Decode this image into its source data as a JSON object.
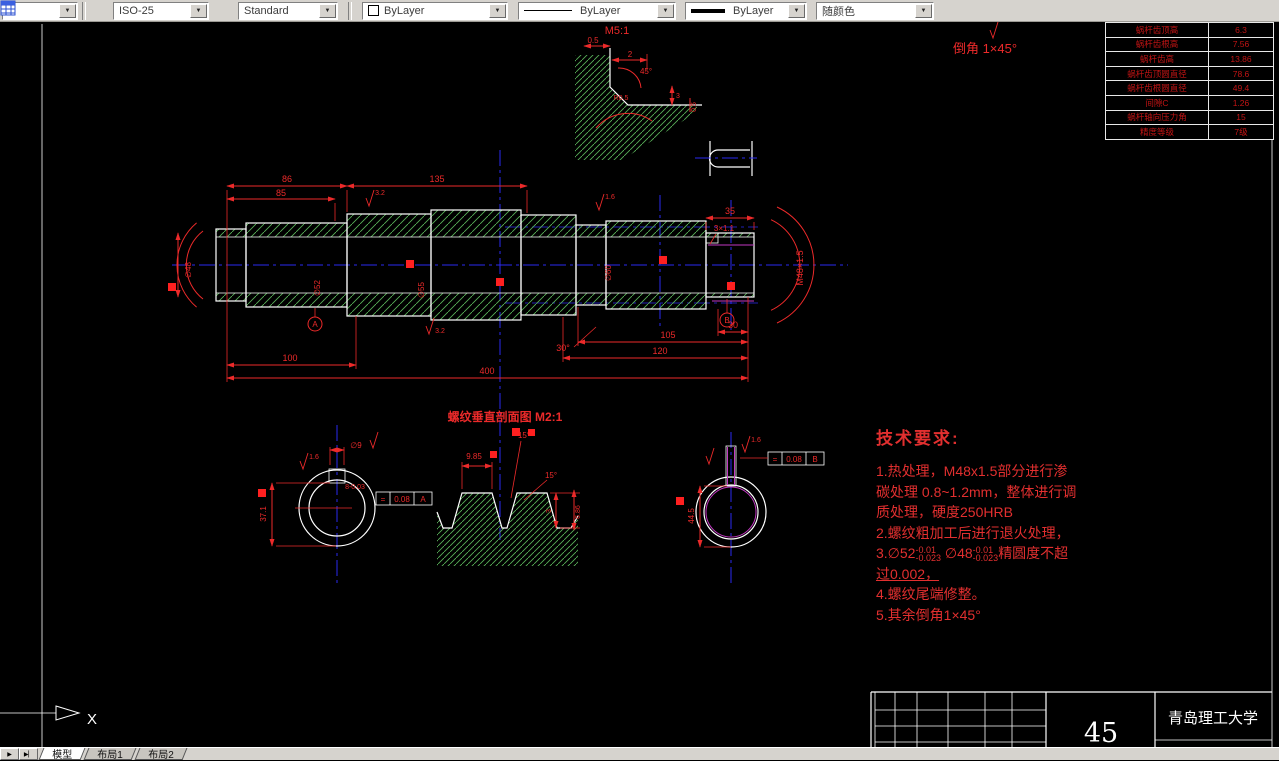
{
  "toolbar": {
    "layer_value": "",
    "dim_style": "ISO-25",
    "text_style": "Standard",
    "color": "ByLayer",
    "linetype": "ByLayer",
    "lineweight": "ByLayer",
    "plot_style": "随颜色",
    "arrow_glyph": "▼"
  },
  "params_table": {
    "rows": [
      {
        "label": "蜗杆齿顶高",
        "value": "6.3"
      },
      {
        "label": "蜗杆齿根高",
        "value": "7.56"
      },
      {
        "label": "蜗杆齿高",
        "value": "13.86"
      },
      {
        "label": "蜗杆齿顶圆直径",
        "value": "78.6"
      },
      {
        "label": "蜗杆齿根圆直径",
        "value": "49.4"
      },
      {
        "label": "间隙C",
        "value": "1.26"
      },
      {
        "label": "蜗杆轴向压力角",
        "value": "15"
      },
      {
        "label": "精度等级",
        "value": "7级"
      }
    ]
  },
  "annotations": {
    "chamfer_detail_scale": "M5:1",
    "chamfer_note": "倒角 1×45°",
    "thread_section_title": "螺纹垂直剖面图 M2:1"
  },
  "dims": {
    "d86": "86",
    "d85": "85",
    "d135": "135",
    "d35": "35",
    "key": "3×1.1",
    "d100": "100",
    "d400": "400",
    "d105": "105",
    "d120": "120",
    "d30": "30",
    "a30": "30°",
    "thread": "M48×1.5",
    "c05a": "0.5",
    "c2": "2",
    "c45": "45°",
    "cr05": "R0.5",
    "c3": "3",
    "c05b": "0.5",
    "dia9": "∅9",
    "w371": "37.1",
    "kw8": "8-0.03",
    "d445": "44.5",
    "t985": "9.85",
    "t15": "15°",
    "t3": "3",
    "t686": "6.86",
    "dia48": "∅48",
    "dia52": "∅52",
    "dia55": "∅55",
    "dia60": "∅60",
    "sf32": "3.2",
    "sf16": "1.6",
    "par": "=",
    "tol008": "0.08",
    "dA": "A",
    "dB": "B"
  },
  "tech_req": {
    "title": "技术要求:",
    "line1a": "1.热处理，M48x1.5部分进行渗",
    "line1b": "碳处理 0.8~1.2mm，整体进行调",
    "line1c": "质处理，硬度250HRB",
    "line2": "2.螺纹粗加工后进行退火处理，",
    "line3_p1": "3.∅52",
    "line3_t1top": "-0.01",
    "line3_t1bot": "-0.023",
    "line3_p2": "∅48",
    "line3_t2top": "-0.01",
    "line3_t2bot": "-0.023",
    "line3_p3": "精圆度不超",
    "line3b": "过0.002，",
    "line4": "4.螺纹尾端修整。",
    "line5": "5.其余倒角1×45°"
  },
  "title_block": {
    "material": "45",
    "organization": "青岛理工大学"
  },
  "tabs": {
    "nav_next": "▶",
    "nav_last": "▶▏",
    "model": "模型",
    "layout1": "布局1",
    "layout2": "布局2"
  },
  "ucs": {
    "x_label": "X"
  },
  "colors": {
    "dim_red": "#ec2a2a",
    "hatch_green": "#58b058",
    "centerline_blue": "#2a2af0",
    "keyway_magenta": "#c238c2"
  }
}
